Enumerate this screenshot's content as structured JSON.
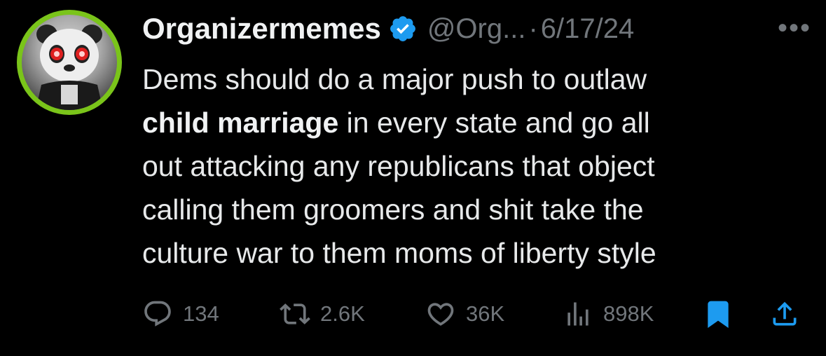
{
  "tweet": {
    "display_name": "Organizermemes",
    "handle": "@Org...",
    "separator": "·",
    "date": "6/17/24",
    "more_glyph": "•••",
    "body": [
      {
        "text": "Dems should do a major push to outlaw"
      },
      {
        "bold": "child marriage",
        "text": " in every state  and go all"
      },
      {
        "text": "out attacking any republicans that object"
      },
      {
        "text": "calling them groomers and shit take the"
      },
      {
        "text": "culture war to them moms of liberty style"
      }
    ]
  },
  "actions": {
    "replies": "134",
    "reposts": "2.6K",
    "likes": "36K",
    "views": "898K"
  },
  "colors": {
    "background": "#000000",
    "text": "#e7e9ea",
    "muted": "#71767b",
    "verified": "#1d9bf0",
    "bookmark": "#1d9bf0",
    "avatar_ring": "#7ac41a"
  },
  "icons": {
    "verified": "verified-badge-icon",
    "reply": "reply-icon",
    "repost": "repost-icon",
    "like": "heart-icon",
    "views": "views-chart-icon",
    "bookmark": "bookmark-icon",
    "share": "share-icon",
    "more": "more-icon"
  }
}
